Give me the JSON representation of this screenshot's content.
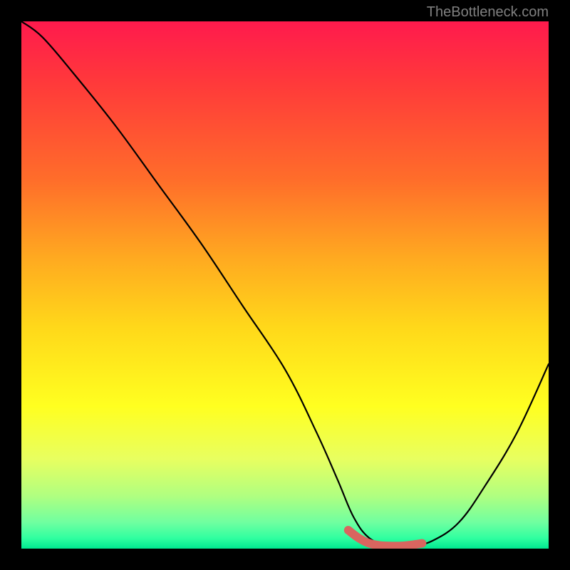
{
  "watermark": "TheBottleneck.com",
  "chart_data": {
    "type": "line",
    "title": "",
    "xlabel": "",
    "ylabel": "",
    "xlim": [
      0,
      100
    ],
    "ylim": [
      0,
      100
    ],
    "background_gradient_stops": [
      {
        "pos": 0,
        "color": "#ff1a4d"
      },
      {
        "pos": 12,
        "color": "#ff3a3a"
      },
      {
        "pos": 30,
        "color": "#ff6d2a"
      },
      {
        "pos": 45,
        "color": "#ffaa20"
      },
      {
        "pos": 58,
        "color": "#ffd81a"
      },
      {
        "pos": 73,
        "color": "#ffff20"
      },
      {
        "pos": 83,
        "color": "#e8ff60"
      },
      {
        "pos": 90,
        "color": "#b0ff80"
      },
      {
        "pos": 95,
        "color": "#70ffa0"
      },
      {
        "pos": 98,
        "color": "#30ffa0"
      },
      {
        "pos": 100,
        "color": "#00e890"
      }
    ],
    "series": [
      {
        "name": "bottleneck-curve",
        "color": "#000000",
        "x": [
          0,
          4,
          10,
          18,
          26,
          34,
          42,
          50,
          56,
          60,
          63,
          66,
          70,
          74,
          78,
          83,
          88,
          94,
          100
        ],
        "values": [
          100,
          97,
          90,
          80,
          69,
          58,
          46,
          34,
          22,
          13,
          6,
          2,
          0.5,
          0.5,
          1.5,
          5,
          12,
          22,
          35
        ]
      },
      {
        "name": "optimal-range-highlight",
        "color": "#d9655f",
        "x": [
          62,
          64,
          66,
          68,
          70,
          72,
          74,
          76
        ],
        "values": [
          3.5,
          2,
          1,
          0.6,
          0.5,
          0.5,
          0.7,
          1
        ]
      }
    ]
  }
}
